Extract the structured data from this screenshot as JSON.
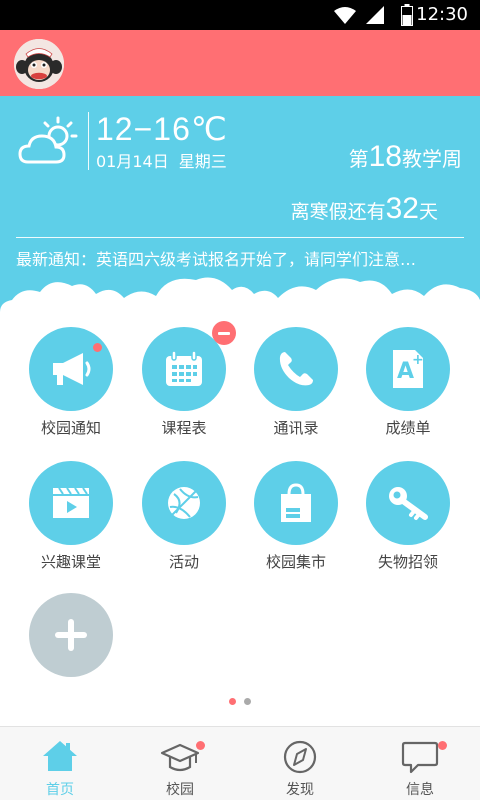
{
  "status_bar": {
    "time": "12:30"
  },
  "weather": {
    "temperature": "12−16℃",
    "date": "01月14日",
    "weekday": "星期三"
  },
  "week": {
    "prefix": "第",
    "number": "18",
    "suffix": "教学周"
  },
  "vacation": {
    "prefix": "离寒假还有",
    "days": "32",
    "suffix": "天"
  },
  "notice": "最新通知：英语四六级考试报名开始了，请同学们注意…",
  "grid": [
    {
      "label": "校园通知",
      "icon": "megaphone-icon",
      "badge": "dot"
    },
    {
      "label": "课程表",
      "icon": "calendar-icon",
      "badge": "minus"
    },
    {
      "label": "通讯录",
      "icon": "phone-icon",
      "badge": ""
    },
    {
      "label": "成绩单",
      "icon": "grade-a-plus-icon",
      "badge": ""
    },
    {
      "label": "兴趣课堂",
      "icon": "video-player-icon",
      "badge": ""
    },
    {
      "label": "活动",
      "icon": "basketball-icon",
      "badge": ""
    },
    {
      "label": "校园集市",
      "icon": "shopping-bag-icon",
      "badge": ""
    },
    {
      "label": "失物招领",
      "icon": "key-icon",
      "badge": ""
    }
  ],
  "pager": {
    "pages": 2,
    "current": 1
  },
  "bottom_nav": [
    {
      "label": "首页",
      "icon": "home-icon",
      "active": true,
      "badge": false
    },
    {
      "label": "校园",
      "icon": "graduation-cap-icon",
      "active": false,
      "badge": true
    },
    {
      "label": "发现",
      "icon": "compass-icon",
      "active": false,
      "badge": false
    },
    {
      "label": "信息",
      "icon": "chat-bubble-icon",
      "active": false,
      "badge": true
    }
  ],
  "colors": {
    "header": "#ff6f73",
    "accent": "#5ecfe8",
    "badge": "#ff6f73",
    "add_button": "#bfcdd2",
    "nav_inactive": "#555555"
  }
}
